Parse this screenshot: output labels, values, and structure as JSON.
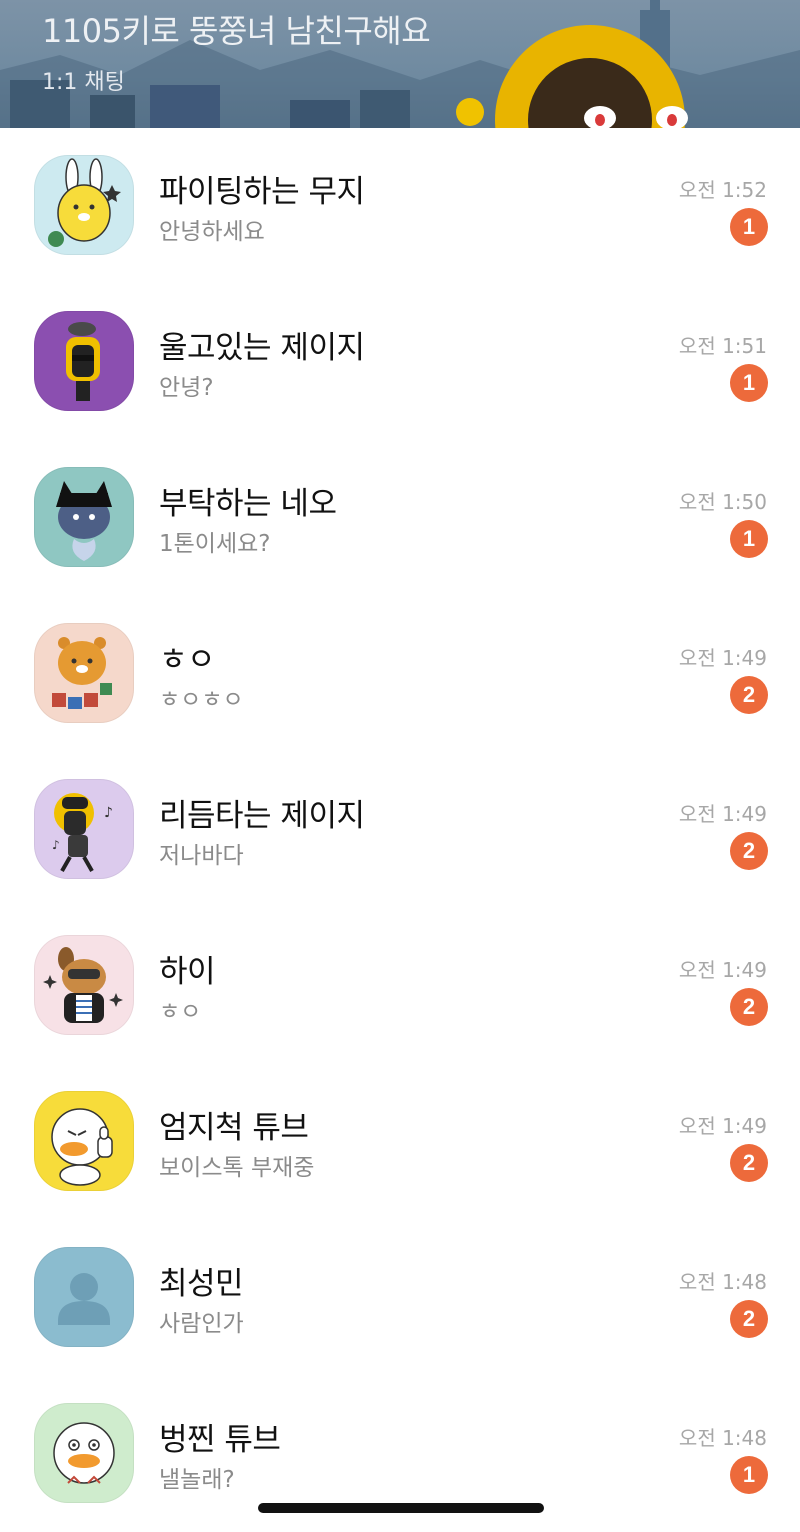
{
  "header": {
    "title": "1105키로 뚱쭝녀 남친구해요",
    "subtitle": "1:1 채팅",
    "colors": {
      "sky": "#7d93a7",
      "character": "#e8b400"
    }
  },
  "chats": [
    {
      "name": "파이팅하는 무지",
      "preview": "안녕하세요",
      "time": "오전 1:52",
      "unread": "1",
      "avatar_icon": "muzi-fighting-icon",
      "avatar_bg": "#cdeaf0"
    },
    {
      "name": "울고있는 제이지",
      "preview": "안녕?",
      "time": "오전 1:51",
      "unread": "1",
      "avatar_icon": "jayg-crying-icon",
      "avatar_bg": "#8b4fb0"
    },
    {
      "name": "부탁하는 네오",
      "preview": "1톤이세요?",
      "time": "오전 1:50",
      "unread": "1",
      "avatar_icon": "neo-pleading-icon",
      "avatar_bg": "#8fc7c2"
    },
    {
      "name": "ㅎㅇ",
      "preview": "ㅎㅇㅎㅇ",
      "time": "오전 1:49",
      "unread": "2",
      "avatar_icon": "ryan-blocks-icon",
      "avatar_bg": "#f5d8cb"
    },
    {
      "name": "리듬타는 제이지",
      "preview": "저나바다",
      "time": "오전 1:49",
      "unread": "2",
      "avatar_icon": "jayg-rhythm-icon",
      "avatar_bg": "#dccbed"
    },
    {
      "name": "하이",
      "preview": "ㅎㅇ",
      "time": "오전 1:49",
      "unread": "2",
      "avatar_icon": "frodo-sparkle-icon",
      "avatar_bg": "#f7e1e6"
    },
    {
      "name": "엄지척 튜브",
      "preview": "보이스톡 부재중",
      "time": "오전 1:49",
      "unread": "2",
      "avatar_icon": "tube-thumbsup-icon",
      "avatar_bg": "#f7dc3a"
    },
    {
      "name": "최성민",
      "preview": "사람인가",
      "time": "오전 1:48",
      "unread": "2",
      "avatar_icon": "default-person-icon",
      "avatar_bg": "#8bbccf"
    },
    {
      "name": "벙찐 튜브",
      "preview": "낼놀래?",
      "time": "오전 1:48",
      "unread": "1",
      "avatar_icon": "tube-dazed-icon",
      "avatar_bg": "#cfeccd"
    }
  ],
  "badge_color": "#ed6a3b"
}
